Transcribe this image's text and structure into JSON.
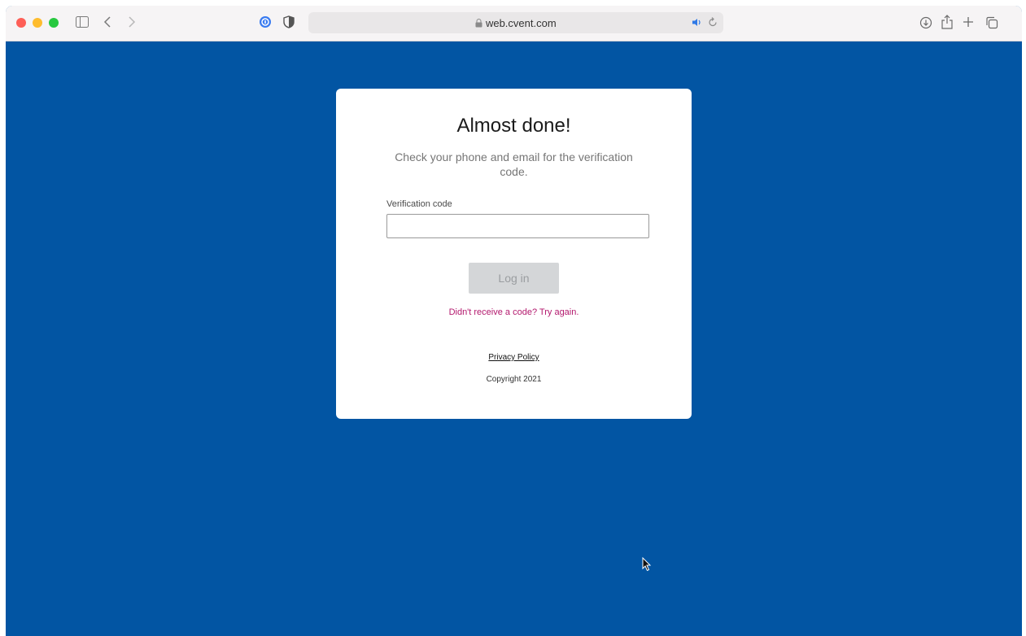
{
  "browser": {
    "url": "web.cvent.com",
    "icons": {
      "close": "close-dot",
      "minimize": "minimize-dot",
      "zoom": "zoom-dot",
      "sidebar": "sidebar-icon",
      "back": "back-icon",
      "forward": "forward-icon",
      "password_manager": "password-manager-icon",
      "privacy": "shield-icon",
      "lock": "lock-icon",
      "audio": "speaker-icon",
      "reload": "reload-icon",
      "downloads": "download-icon",
      "share": "share-icon",
      "new_tab": "plus-icon",
      "tabs": "tabs-icon"
    },
    "colors": {
      "red": "#fe5f57",
      "yellow": "#febc2e",
      "green": "#28c840"
    }
  },
  "page": {
    "background": "#0255a3",
    "title": "Almost done!",
    "subtitle": "Check your phone and email for the verification code.",
    "code_label": "Verification code",
    "code_value": "",
    "login_label": "Log in",
    "retry_link": "Didn't receive a code? Try again.",
    "privacy_link": "Privacy Policy",
    "copyright": "Copyright 2021",
    "link_color": "#b3186d"
  }
}
